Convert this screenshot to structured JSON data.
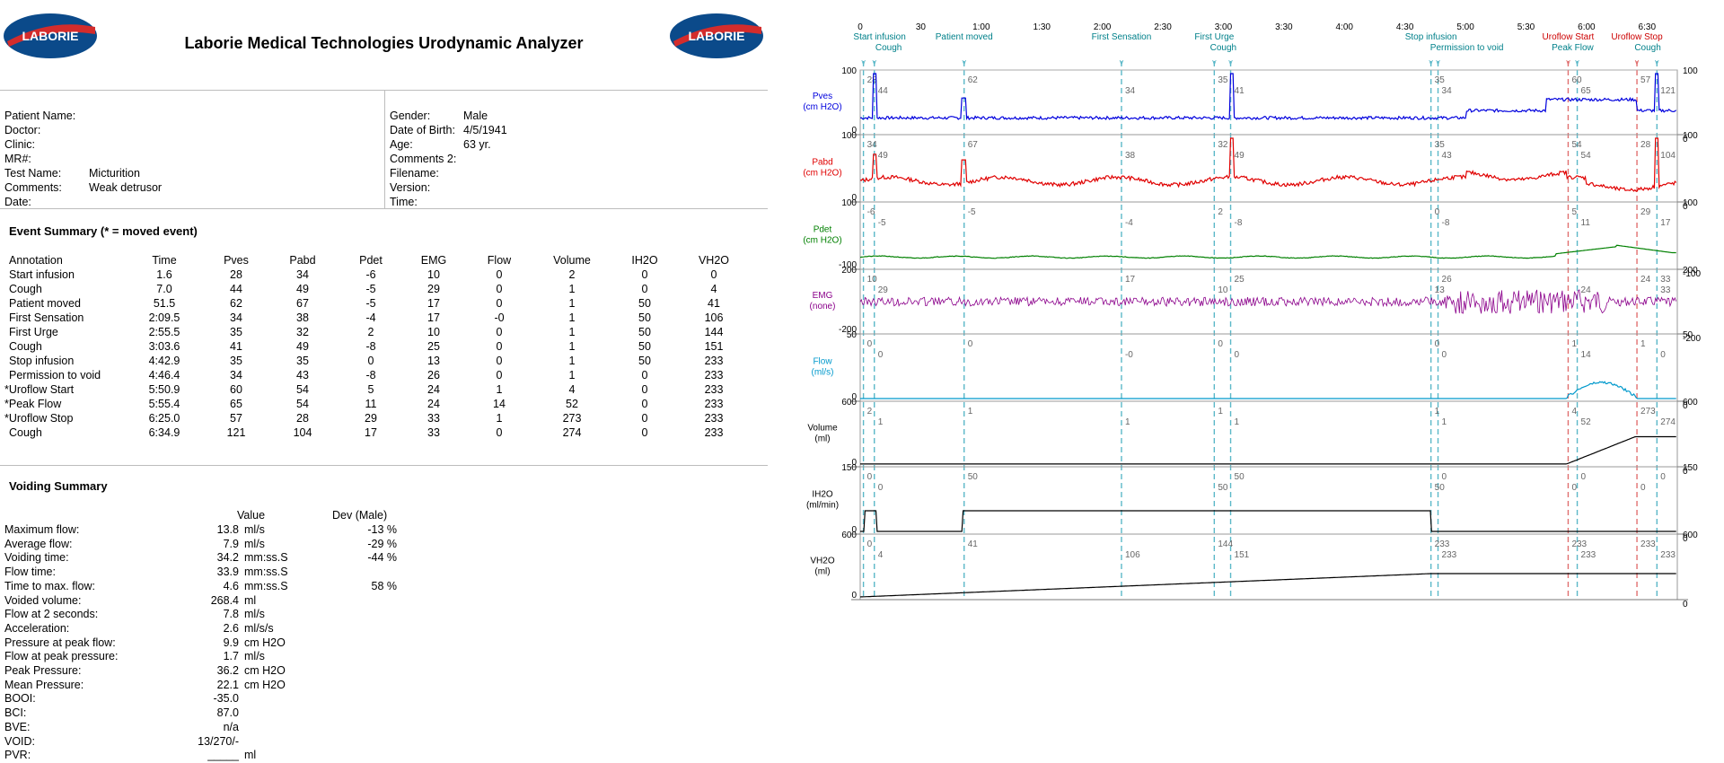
{
  "header": {
    "title": "Laborie Medical Technologies Urodynamic Analyzer",
    "logo_text": "LABORIE"
  },
  "patient": {
    "left": [
      {
        "label": "Patient Name:",
        "value": ""
      },
      {
        "label": "Doctor:",
        "value": ""
      },
      {
        "label": "Clinic:",
        "value": ""
      },
      {
        "label": "MR#:",
        "value": ""
      },
      {
        "label": "Test Name:",
        "value": "Micturition"
      },
      {
        "label": "Comments:",
        "value": "Weak detrusor"
      },
      {
        "label": "Date:",
        "value": ""
      }
    ],
    "right": [
      {
        "label": "Gender:",
        "value": "Male"
      },
      {
        "label": "Date of Birth:",
        "value": "4/5/1941"
      },
      {
        "label": "Age:",
        "value": "63 yr."
      },
      {
        "label": "Comments 2:",
        "value": ""
      },
      {
        "label": "Filename:",
        "value": ""
      },
      {
        "label": "Version:",
        "value": ""
      },
      {
        "label": "Time:",
        "value": ""
      }
    ]
  },
  "event_summary": {
    "title": "Event Summary (* = moved event)",
    "columns": [
      "Annotation",
      "Time",
      "Pves",
      "Pabd",
      "Pdet",
      "EMG",
      "Flow",
      "Volume",
      "IH2O",
      "VH2O"
    ],
    "rows": [
      [
        "Start infusion",
        "1.6",
        "28",
        "34",
        "-6",
        "10",
        "0",
        "2",
        "0",
        "0"
      ],
      [
        "Cough",
        "7.0",
        "44",
        "49",
        "-5",
        "29",
        "0",
        "1",
        "0",
        "4"
      ],
      [
        "Patient moved",
        "51.5",
        "62",
        "67",
        "-5",
        "17",
        "0",
        "1",
        "50",
        "41"
      ],
      [
        "First Sensation",
        "2:09.5",
        "34",
        "38",
        "-4",
        "17",
        "-0",
        "1",
        "50",
        "106"
      ],
      [
        "First Urge",
        "2:55.5",
        "35",
        "32",
        "2",
        "10",
        "0",
        "1",
        "50",
        "144"
      ],
      [
        "Cough",
        "3:03.6",
        "41",
        "49",
        "-8",
        "25",
        "0",
        "1",
        "50",
        "151"
      ],
      [
        "Stop infusion",
        "4:42.9",
        "35",
        "35",
        "0",
        "13",
        "0",
        "1",
        "50",
        "233"
      ],
      [
        "Permission to void",
        "4:46.4",
        "34",
        "43",
        "-8",
        "26",
        "0",
        "1",
        "0",
        "233"
      ],
      [
        "*Uroflow Start",
        "5:50.9",
        "60",
        "54",
        "5",
        "24",
        "1",
        "4",
        "0",
        "233"
      ],
      [
        "*Peak Flow",
        "5:55.4",
        "65",
        "54",
        "11",
        "24",
        "14",
        "52",
        "0",
        "233"
      ],
      [
        "*Uroflow Stop",
        "6:25.0",
        "57",
        "28",
        "29",
        "33",
        "1",
        "273",
        "0",
        "233"
      ],
      [
        "Cough",
        "6:34.9",
        "121",
        "104",
        "17",
        "33",
        "0",
        "274",
        "0",
        "233"
      ]
    ]
  },
  "voiding_summary": {
    "title": "Voiding Summary",
    "col_value": "Value",
    "col_dev": "Dev (Male)",
    "rows": [
      {
        "label": "Maximum flow:",
        "value": "13.8",
        "unit": "ml/s",
        "dev": "-13 %"
      },
      {
        "label": "Average flow:",
        "value": "7.9",
        "unit": "ml/s",
        "dev": "-29 %"
      },
      {
        "label": "Voiding time:",
        "value": "34.2",
        "unit": "mm:ss.S",
        "dev": "-44 %"
      },
      {
        "label": "Flow time:",
        "value": "33.9",
        "unit": "mm:ss.S",
        "dev": ""
      },
      {
        "label": "Time to max. flow:",
        "value": "4.6",
        "unit": "mm:ss.S",
        "dev": "58 %"
      },
      {
        "label": "Voided volume:",
        "value": "268.4",
        "unit": "ml",
        "dev": ""
      },
      {
        "label": "Flow at 2 seconds:",
        "value": "7.8",
        "unit": "ml/s",
        "dev": ""
      },
      {
        "label": "Acceleration:",
        "value": "2.6",
        "unit": "ml/s/s",
        "dev": ""
      },
      {
        "label": "Pressure at peak flow:",
        "value": "9.9",
        "unit": "cm H2O",
        "dev": ""
      },
      {
        "label": "Flow at peak pressure:",
        "value": "1.7",
        "unit": "ml/s",
        "dev": ""
      },
      {
        "label": "Peak Pressure:",
        "value": "36.2",
        "unit": "cm H2O",
        "dev": ""
      },
      {
        "label": "Mean Pressure:",
        "value": "22.1",
        "unit": "cm H2O",
        "dev": ""
      },
      {
        "label": "BOOI:",
        "value": "-35.0",
        "unit": "",
        "dev": ""
      },
      {
        "label": "BCI:",
        "value": "87.0",
        "unit": "",
        "dev": ""
      },
      {
        "label": "BVE:",
        "value": "n/a",
        "unit": "",
        "dev": ""
      },
      {
        "label": "VOID:",
        "value": "13/270/-",
        "unit": "",
        "dev": ""
      },
      {
        "label": "PVR:",
        "value": "_____",
        "unit": "ml",
        "dev": ""
      }
    ]
  },
  "chart_data": {
    "type": "line",
    "x_ticks": [
      "0",
      "30",
      "1:00",
      "1:30",
      "2:00",
      "2:30",
      "3:00",
      "3:30",
      "4:00",
      "4:30",
      "5:00",
      "5:30",
      "6:00",
      "6:30"
    ],
    "x_range_s": [
      0,
      405
    ],
    "events": [
      {
        "t": 1.6,
        "top": "Start infusion",
        "bottom": "Cough",
        "top_color": "#00808a",
        "bottom_color": "#00808a"
      },
      {
        "t": 51.5,
        "top": "Patient moved",
        "bottom": "",
        "top_color": "#00808a"
      },
      {
        "t": 129.5,
        "top": "First Sensation",
        "bottom": "",
        "top_color": "#00808a"
      },
      {
        "t": 175.5,
        "top": "First Urge",
        "bottom": "Cough",
        "top_color": "#00808a",
        "bottom_color": "#00808a"
      },
      {
        "t": 282.9,
        "top": "Stop infusion",
        "bottom": "Permission to void",
        "top_color": "#00808a",
        "bottom_color": "#00808a"
      },
      {
        "t": 350.9,
        "top": "Uroflow Start",
        "bottom": "Peak Flow",
        "top_color": "#cc0000",
        "bottom_color": "#00808a"
      },
      {
        "t": 385.0,
        "top": "Uroflow Stop",
        "bottom": "Cough",
        "top_color": "#cc0000",
        "bottom_color": "#00808a"
      }
    ],
    "channels": [
      {
        "name": "Pves",
        "unit": "(cm H2O)",
        "color": "#0000dd",
        "max": "100",
        "min": "0",
        "labels": [
          "28",
          "44",
          "62",
          "34",
          "35",
          "41",
          "35",
          "34",
          "60",
          "65",
          "57",
          "121"
        ]
      },
      {
        "name": "Pabd",
        "unit": "(cm H2O)",
        "color": "#e00000",
        "max": "100",
        "min": "0",
        "labels": [
          "34",
          "49",
          "67",
          "38",
          "32",
          "49",
          "35",
          "43",
          "54",
          "54",
          "28",
          "104"
        ]
      },
      {
        "name": "Pdet",
        "unit": "(cm H2O)",
        "color": "#008000",
        "max": "100",
        "min": "-100",
        "labels": [
          "-6",
          "-5",
          "-5",
          "-4",
          "2",
          "-8",
          "0",
          "-8",
          "5",
          "11",
          "29",
          "17"
        ]
      },
      {
        "name": "EMG",
        "unit": "(none)",
        "color": "#8b008b",
        "max": "200",
        "min": "-200",
        "labels": [
          "10",
          "29",
          "17",
          "10",
          "25",
          "13",
          "26",
          "24",
          "24",
          "33",
          "33"
        ]
      },
      {
        "name": "Flow",
        "unit": "(ml/s)",
        "color": "#0099cc",
        "max": "50",
        "min": "0",
        "labels": [
          "0",
          "0",
          "0",
          "-0",
          "0",
          "0",
          "0",
          "0",
          "1",
          "14",
          "1",
          "0"
        ]
      },
      {
        "name": "Volume",
        "unit": "(ml)",
        "color": "#000000",
        "max": "600",
        "min": "0",
        "labels": [
          "2",
          "1",
          "1",
          "1",
          "1",
          "1",
          "1",
          "1",
          "4",
          "52",
          "273",
          "274"
        ]
      },
      {
        "name": "IH2O",
        "unit": "(ml/min)",
        "color": "#000000",
        "max": "150",
        "min": "0",
        "labels": [
          "0",
          "0",
          "50",
          "50",
          "50",
          "50",
          "0",
          "0",
          "0",
          "0",
          "0"
        ]
      },
      {
        "name": "VH2O",
        "unit": "(ml)",
        "color": "#000000",
        "max": "600",
        "min": "0",
        "labels": [
          "0",
          "4",
          "41",
          "106",
          "144",
          "151",
          "233",
          "233",
          "233",
          "233",
          "233",
          "233"
        ]
      }
    ]
  }
}
